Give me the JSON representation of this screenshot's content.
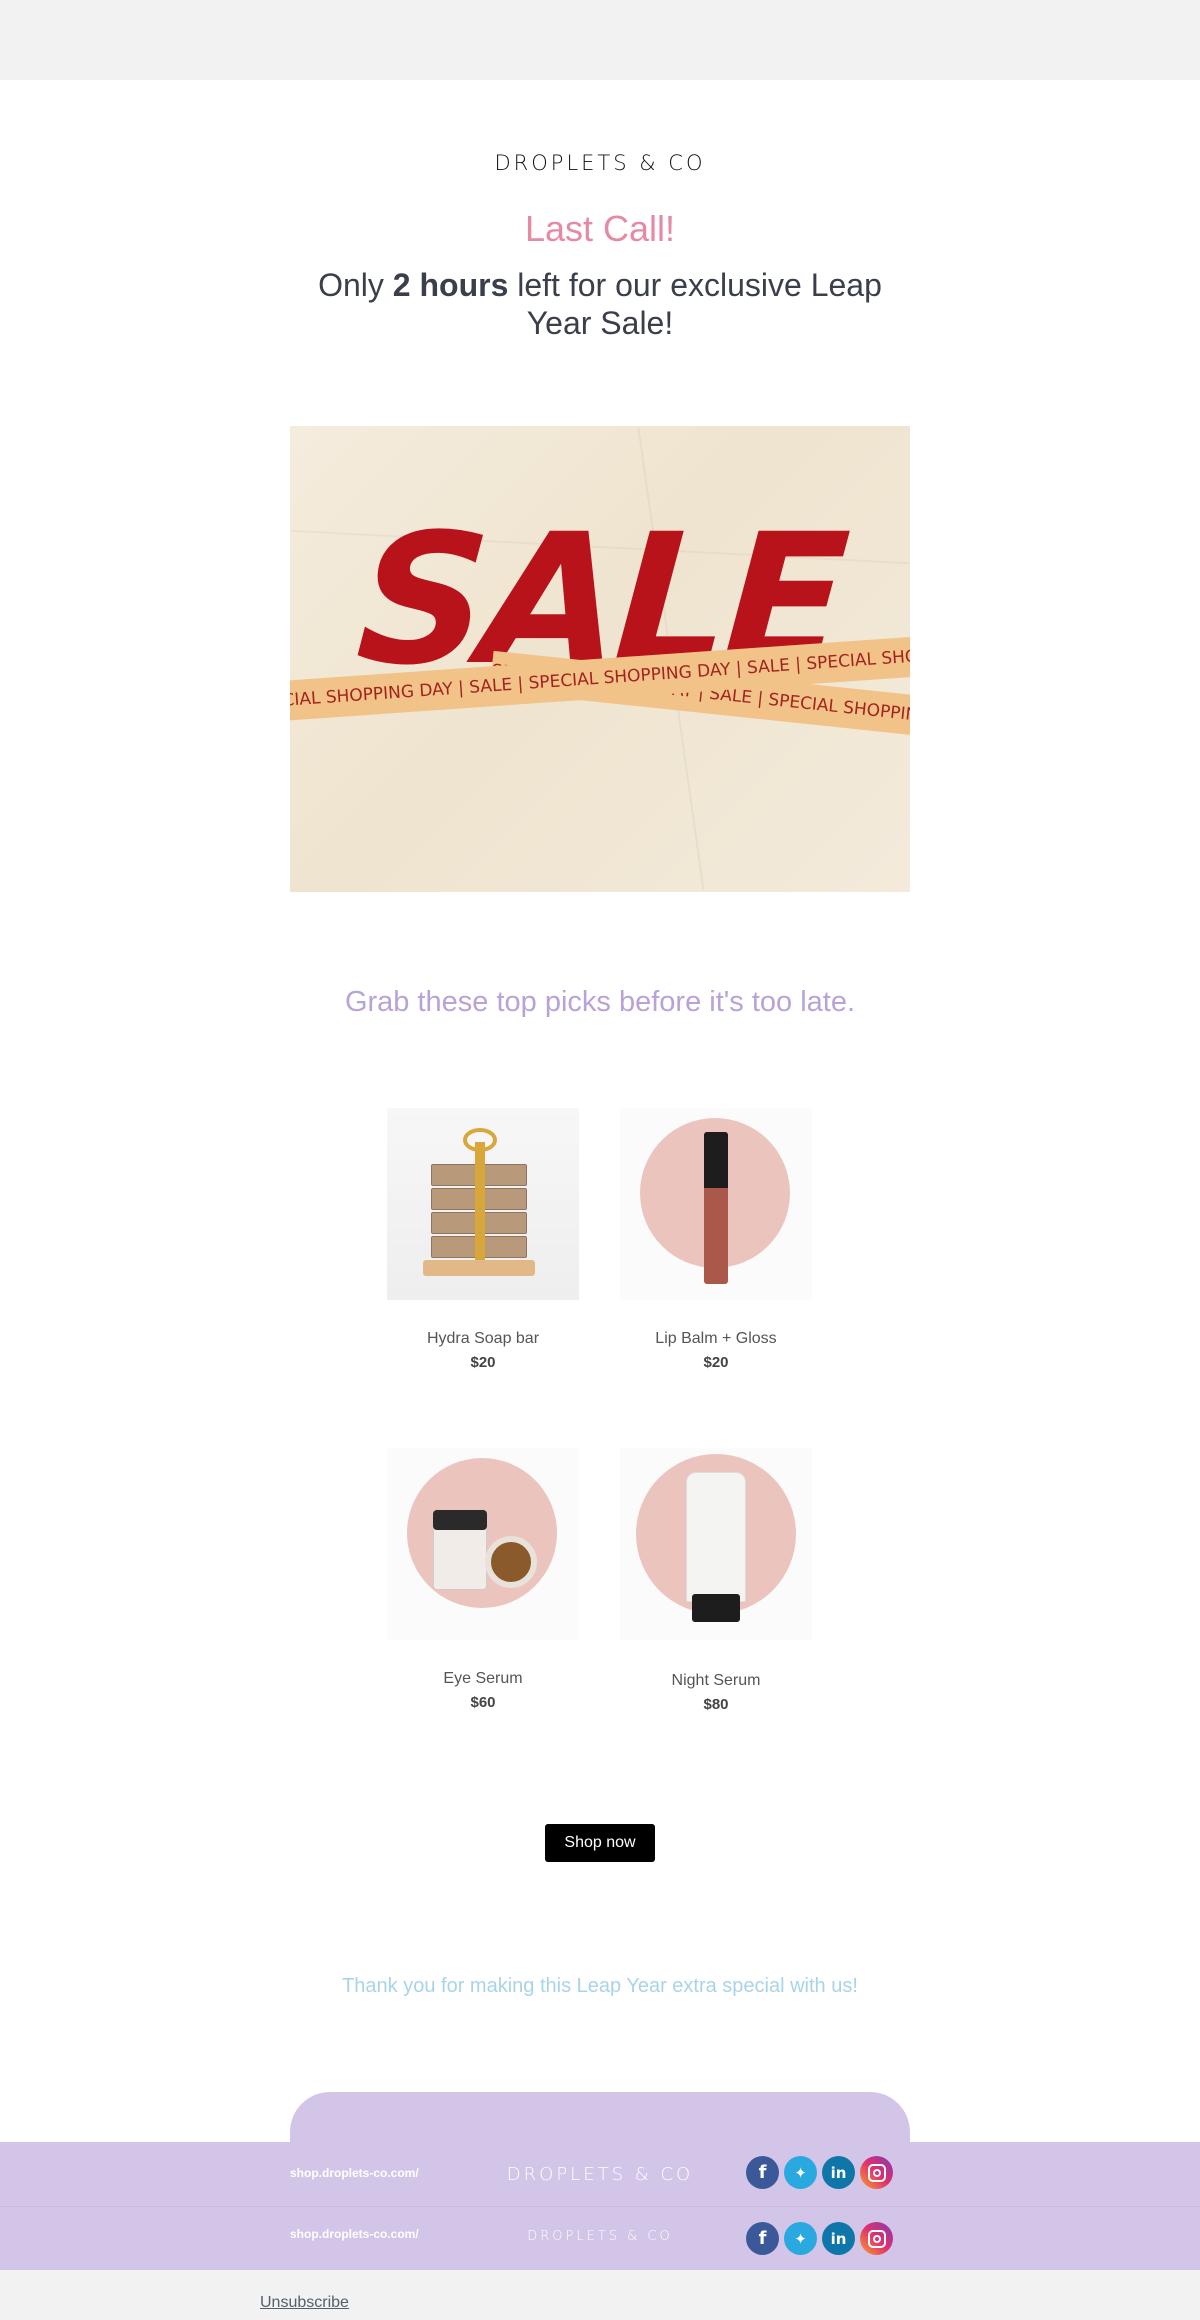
{
  "header": {
    "brand": "DROPLETS & CO",
    "headline": "Last Call!",
    "sub_before": "Only ",
    "sub_bold": "2 hours",
    "sub_after": " left for our exclusive Leap Year Sale!"
  },
  "hero": {
    "sale_text": "SALE",
    "tape_top": "SPECIAL SHOPPING DAY | SALE | SPECIAL SHOPPING DAY | SALE | SPECIAL SHOPPING DAY | SALE | SPECIAL SHOPPING",
    "tape_bottom": "SPECIAL SHOPPING DAY | SALE | SPECIAL SHOPPING DAY | SALE | SPECIAL SHOPPING"
  },
  "picks": {
    "heading": "Grab these top picks before it's too late."
  },
  "products": [
    {
      "name": "Hydra Soap bar",
      "price": "$20"
    },
    {
      "name": "Lip Balm + Gloss",
      "price": "$20"
    },
    {
      "name": "Eye Serum",
      "price": "$60"
    },
    {
      "name": "Night Serum",
      "price": "$80"
    }
  ],
  "cta": {
    "label": "Shop now"
  },
  "thanks": "Thank you for making this Leap Year extra special with us!",
  "footer": {
    "rows": [
      {
        "link": "shop.droplets-co.com/",
        "brand": "DROPLETS & CO"
      },
      {
        "link": "shop.droplets-co.com/",
        "brand": "DROPLETS & CO"
      }
    ],
    "socials": [
      "f",
      "t",
      "in",
      "ig"
    ],
    "unsubscribe": "Unsubscribe"
  },
  "colors": {
    "headline_pink": "#e68aa4",
    "picks_purple": "#b9a2d6",
    "thanks_blue": "#a8d4ea",
    "footer_lavender": "#d3c5e8",
    "sale_red": "#b8131b",
    "tape_orange": "#f1c389"
  },
  "icons": [
    "facebook-icon",
    "twitter-icon",
    "linkedin-icon",
    "instagram-icon"
  ]
}
